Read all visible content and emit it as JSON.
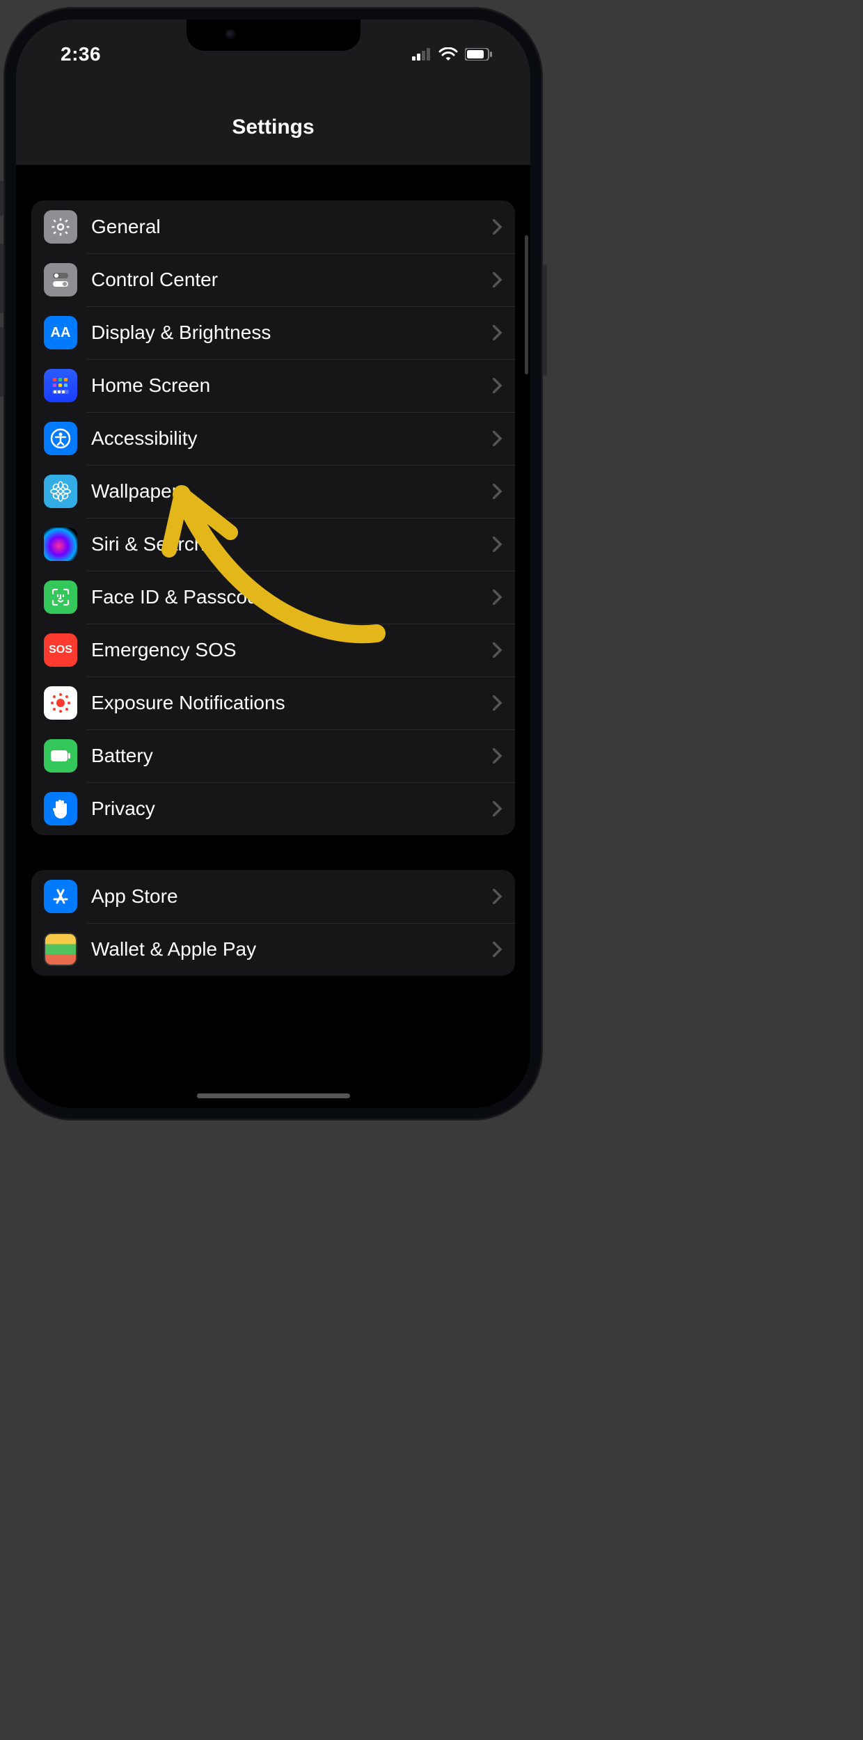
{
  "status": {
    "time": "2:36"
  },
  "nav": {
    "title": "Settings"
  },
  "annotation": {
    "target": "Accessibility",
    "color": "#e3b71a"
  },
  "groups": [
    {
      "rows": [
        {
          "id": "general",
          "label": "General",
          "icon": "gear",
          "tint": "gray"
        },
        {
          "id": "control-center",
          "label": "Control Center",
          "icon": "switches",
          "tint": "gray"
        },
        {
          "id": "display-brightness",
          "label": "Display & Brightness",
          "icon": "aa",
          "tint": "blue"
        },
        {
          "id": "home-screen",
          "label": "Home Screen",
          "icon": "apps-grid",
          "tint": "grid"
        },
        {
          "id": "accessibility",
          "label": "Accessibility",
          "icon": "person-circle",
          "tint": "blue"
        },
        {
          "id": "wallpaper",
          "label": "Wallpaper",
          "icon": "flower",
          "tint": "cyan"
        },
        {
          "id": "siri-search",
          "label": "Siri & Search",
          "icon": "siri",
          "tint": "siri"
        },
        {
          "id": "face-id-passcode",
          "label": "Face ID & Passcode",
          "icon": "faceid",
          "tint": "green"
        },
        {
          "id": "emergency-sos",
          "label": "Emergency SOS",
          "icon": "sos",
          "tint": "red"
        },
        {
          "id": "exposure-notifications",
          "label": "Exposure Notifications",
          "icon": "exposure",
          "tint": "white"
        },
        {
          "id": "battery",
          "label": "Battery",
          "icon": "battery",
          "tint": "green"
        },
        {
          "id": "privacy",
          "label": "Privacy",
          "icon": "hand",
          "tint": "blue"
        }
      ]
    },
    {
      "rows": [
        {
          "id": "app-store",
          "label": "App Store",
          "icon": "appstore",
          "tint": "blue"
        },
        {
          "id": "wallet-applepay",
          "label": "Wallet & Apple Pay",
          "icon": "wallet",
          "tint": "wallet"
        }
      ]
    }
  ]
}
